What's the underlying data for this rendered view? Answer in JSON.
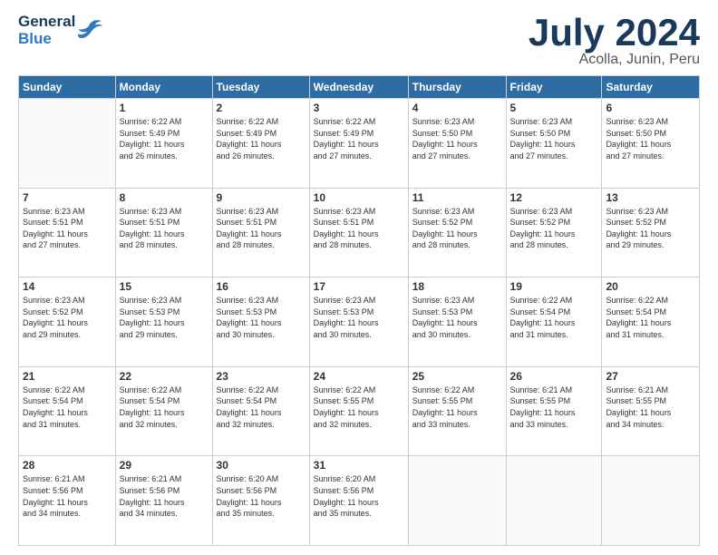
{
  "logo": {
    "general": "General",
    "blue": "Blue"
  },
  "title": {
    "month_year": "July 2024",
    "location": "Acolla, Junin, Peru"
  },
  "weekdays": [
    "Sunday",
    "Monday",
    "Tuesday",
    "Wednesday",
    "Thursday",
    "Friday",
    "Saturday"
  ],
  "weeks": [
    [
      {
        "day": "",
        "info": ""
      },
      {
        "day": "1",
        "info": "Sunrise: 6:22 AM\nSunset: 5:49 PM\nDaylight: 11 hours\nand 26 minutes."
      },
      {
        "day": "2",
        "info": "Sunrise: 6:22 AM\nSunset: 5:49 PM\nDaylight: 11 hours\nand 26 minutes."
      },
      {
        "day": "3",
        "info": "Sunrise: 6:22 AM\nSunset: 5:49 PM\nDaylight: 11 hours\nand 27 minutes."
      },
      {
        "day": "4",
        "info": "Sunrise: 6:23 AM\nSunset: 5:50 PM\nDaylight: 11 hours\nand 27 minutes."
      },
      {
        "day": "5",
        "info": "Sunrise: 6:23 AM\nSunset: 5:50 PM\nDaylight: 11 hours\nand 27 minutes."
      },
      {
        "day": "6",
        "info": "Sunrise: 6:23 AM\nSunset: 5:50 PM\nDaylight: 11 hours\nand 27 minutes."
      }
    ],
    [
      {
        "day": "7",
        "info": "Sunrise: 6:23 AM\nSunset: 5:51 PM\nDaylight: 11 hours\nand 27 minutes."
      },
      {
        "day": "8",
        "info": "Sunrise: 6:23 AM\nSunset: 5:51 PM\nDaylight: 11 hours\nand 28 minutes."
      },
      {
        "day": "9",
        "info": "Sunrise: 6:23 AM\nSunset: 5:51 PM\nDaylight: 11 hours\nand 28 minutes."
      },
      {
        "day": "10",
        "info": "Sunrise: 6:23 AM\nSunset: 5:51 PM\nDaylight: 11 hours\nand 28 minutes."
      },
      {
        "day": "11",
        "info": "Sunrise: 6:23 AM\nSunset: 5:52 PM\nDaylight: 11 hours\nand 28 minutes."
      },
      {
        "day": "12",
        "info": "Sunrise: 6:23 AM\nSunset: 5:52 PM\nDaylight: 11 hours\nand 28 minutes."
      },
      {
        "day": "13",
        "info": "Sunrise: 6:23 AM\nSunset: 5:52 PM\nDaylight: 11 hours\nand 29 minutes."
      }
    ],
    [
      {
        "day": "14",
        "info": "Sunrise: 6:23 AM\nSunset: 5:52 PM\nDaylight: 11 hours\nand 29 minutes."
      },
      {
        "day": "15",
        "info": "Sunrise: 6:23 AM\nSunset: 5:53 PM\nDaylight: 11 hours\nand 29 minutes."
      },
      {
        "day": "16",
        "info": "Sunrise: 6:23 AM\nSunset: 5:53 PM\nDaylight: 11 hours\nand 30 minutes."
      },
      {
        "day": "17",
        "info": "Sunrise: 6:23 AM\nSunset: 5:53 PM\nDaylight: 11 hours\nand 30 minutes."
      },
      {
        "day": "18",
        "info": "Sunrise: 6:23 AM\nSunset: 5:53 PM\nDaylight: 11 hours\nand 30 minutes."
      },
      {
        "day": "19",
        "info": "Sunrise: 6:22 AM\nSunset: 5:54 PM\nDaylight: 11 hours\nand 31 minutes."
      },
      {
        "day": "20",
        "info": "Sunrise: 6:22 AM\nSunset: 5:54 PM\nDaylight: 11 hours\nand 31 minutes."
      }
    ],
    [
      {
        "day": "21",
        "info": "Sunrise: 6:22 AM\nSunset: 5:54 PM\nDaylight: 11 hours\nand 31 minutes."
      },
      {
        "day": "22",
        "info": "Sunrise: 6:22 AM\nSunset: 5:54 PM\nDaylight: 11 hours\nand 32 minutes."
      },
      {
        "day": "23",
        "info": "Sunrise: 6:22 AM\nSunset: 5:54 PM\nDaylight: 11 hours\nand 32 minutes."
      },
      {
        "day": "24",
        "info": "Sunrise: 6:22 AM\nSunset: 5:55 PM\nDaylight: 11 hours\nand 32 minutes."
      },
      {
        "day": "25",
        "info": "Sunrise: 6:22 AM\nSunset: 5:55 PM\nDaylight: 11 hours\nand 33 minutes."
      },
      {
        "day": "26",
        "info": "Sunrise: 6:21 AM\nSunset: 5:55 PM\nDaylight: 11 hours\nand 33 minutes."
      },
      {
        "day": "27",
        "info": "Sunrise: 6:21 AM\nSunset: 5:55 PM\nDaylight: 11 hours\nand 34 minutes."
      }
    ],
    [
      {
        "day": "28",
        "info": "Sunrise: 6:21 AM\nSunset: 5:56 PM\nDaylight: 11 hours\nand 34 minutes."
      },
      {
        "day": "29",
        "info": "Sunrise: 6:21 AM\nSunset: 5:56 PM\nDaylight: 11 hours\nand 34 minutes."
      },
      {
        "day": "30",
        "info": "Sunrise: 6:20 AM\nSunset: 5:56 PM\nDaylight: 11 hours\nand 35 minutes."
      },
      {
        "day": "31",
        "info": "Sunrise: 6:20 AM\nSunset: 5:56 PM\nDaylight: 11 hours\nand 35 minutes."
      },
      {
        "day": "",
        "info": ""
      },
      {
        "day": "",
        "info": ""
      },
      {
        "day": "",
        "info": ""
      }
    ]
  ]
}
